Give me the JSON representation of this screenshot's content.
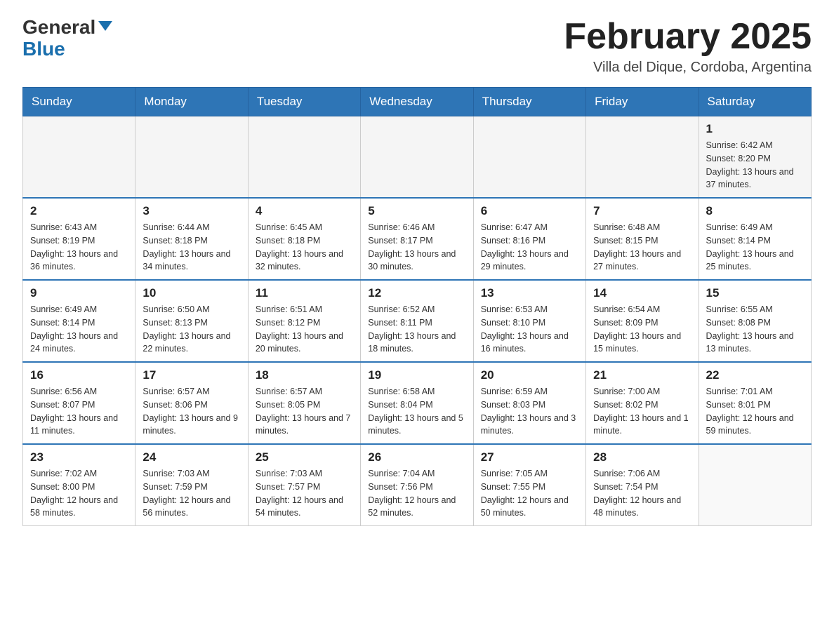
{
  "logo": {
    "text_general": "General",
    "text_blue": "Blue"
  },
  "header": {
    "month_year": "February 2025",
    "location": "Villa del Dique, Cordoba, Argentina"
  },
  "days_of_week": [
    "Sunday",
    "Monday",
    "Tuesday",
    "Wednesday",
    "Thursday",
    "Friday",
    "Saturday"
  ],
  "weeks": [
    [
      {
        "day": "",
        "info": ""
      },
      {
        "day": "",
        "info": ""
      },
      {
        "day": "",
        "info": ""
      },
      {
        "day": "",
        "info": ""
      },
      {
        "day": "",
        "info": ""
      },
      {
        "day": "",
        "info": ""
      },
      {
        "day": "1",
        "info": "Sunrise: 6:42 AM\nSunset: 8:20 PM\nDaylight: 13 hours and 37 minutes."
      }
    ],
    [
      {
        "day": "2",
        "info": "Sunrise: 6:43 AM\nSunset: 8:19 PM\nDaylight: 13 hours and 36 minutes."
      },
      {
        "day": "3",
        "info": "Sunrise: 6:44 AM\nSunset: 8:18 PM\nDaylight: 13 hours and 34 minutes."
      },
      {
        "day": "4",
        "info": "Sunrise: 6:45 AM\nSunset: 8:18 PM\nDaylight: 13 hours and 32 minutes."
      },
      {
        "day": "5",
        "info": "Sunrise: 6:46 AM\nSunset: 8:17 PM\nDaylight: 13 hours and 30 minutes."
      },
      {
        "day": "6",
        "info": "Sunrise: 6:47 AM\nSunset: 8:16 PM\nDaylight: 13 hours and 29 minutes."
      },
      {
        "day": "7",
        "info": "Sunrise: 6:48 AM\nSunset: 8:15 PM\nDaylight: 13 hours and 27 minutes."
      },
      {
        "day": "8",
        "info": "Sunrise: 6:49 AM\nSunset: 8:14 PM\nDaylight: 13 hours and 25 minutes."
      }
    ],
    [
      {
        "day": "9",
        "info": "Sunrise: 6:49 AM\nSunset: 8:14 PM\nDaylight: 13 hours and 24 minutes."
      },
      {
        "day": "10",
        "info": "Sunrise: 6:50 AM\nSunset: 8:13 PM\nDaylight: 13 hours and 22 minutes."
      },
      {
        "day": "11",
        "info": "Sunrise: 6:51 AM\nSunset: 8:12 PM\nDaylight: 13 hours and 20 minutes."
      },
      {
        "day": "12",
        "info": "Sunrise: 6:52 AM\nSunset: 8:11 PM\nDaylight: 13 hours and 18 minutes."
      },
      {
        "day": "13",
        "info": "Sunrise: 6:53 AM\nSunset: 8:10 PM\nDaylight: 13 hours and 16 minutes."
      },
      {
        "day": "14",
        "info": "Sunrise: 6:54 AM\nSunset: 8:09 PM\nDaylight: 13 hours and 15 minutes."
      },
      {
        "day": "15",
        "info": "Sunrise: 6:55 AM\nSunset: 8:08 PM\nDaylight: 13 hours and 13 minutes."
      }
    ],
    [
      {
        "day": "16",
        "info": "Sunrise: 6:56 AM\nSunset: 8:07 PM\nDaylight: 13 hours and 11 minutes."
      },
      {
        "day": "17",
        "info": "Sunrise: 6:57 AM\nSunset: 8:06 PM\nDaylight: 13 hours and 9 minutes."
      },
      {
        "day": "18",
        "info": "Sunrise: 6:57 AM\nSunset: 8:05 PM\nDaylight: 13 hours and 7 minutes."
      },
      {
        "day": "19",
        "info": "Sunrise: 6:58 AM\nSunset: 8:04 PM\nDaylight: 13 hours and 5 minutes."
      },
      {
        "day": "20",
        "info": "Sunrise: 6:59 AM\nSunset: 8:03 PM\nDaylight: 13 hours and 3 minutes."
      },
      {
        "day": "21",
        "info": "Sunrise: 7:00 AM\nSunset: 8:02 PM\nDaylight: 13 hours and 1 minute."
      },
      {
        "day": "22",
        "info": "Sunrise: 7:01 AM\nSunset: 8:01 PM\nDaylight: 12 hours and 59 minutes."
      }
    ],
    [
      {
        "day": "23",
        "info": "Sunrise: 7:02 AM\nSunset: 8:00 PM\nDaylight: 12 hours and 58 minutes."
      },
      {
        "day": "24",
        "info": "Sunrise: 7:03 AM\nSunset: 7:59 PM\nDaylight: 12 hours and 56 minutes."
      },
      {
        "day": "25",
        "info": "Sunrise: 7:03 AM\nSunset: 7:57 PM\nDaylight: 12 hours and 54 minutes."
      },
      {
        "day": "26",
        "info": "Sunrise: 7:04 AM\nSunset: 7:56 PM\nDaylight: 12 hours and 52 minutes."
      },
      {
        "day": "27",
        "info": "Sunrise: 7:05 AM\nSunset: 7:55 PM\nDaylight: 12 hours and 50 minutes."
      },
      {
        "day": "28",
        "info": "Sunrise: 7:06 AM\nSunset: 7:54 PM\nDaylight: 12 hours and 48 minutes."
      },
      {
        "day": "",
        "info": ""
      }
    ]
  ]
}
